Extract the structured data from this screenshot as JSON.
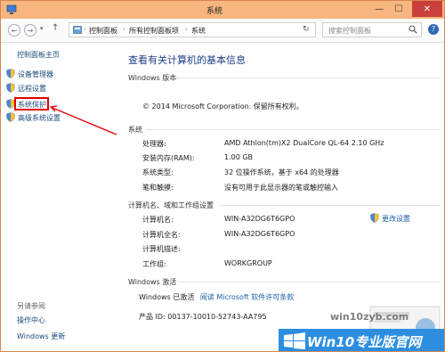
{
  "window": {
    "title": "系统"
  },
  "address": {
    "crumbs": [
      "控制面板",
      "所有控制面板项",
      "系统"
    ],
    "search_placeholder": "搜索控制面板"
  },
  "sidebar": {
    "home": "控制面板主页",
    "items": [
      {
        "label": "设备管理器",
        "icon": "shield-icon"
      },
      {
        "label": "远程设置",
        "icon": "shield-icon"
      },
      {
        "label": "系统保护",
        "icon": "shield-icon",
        "highlighted": true
      },
      {
        "label": "高级系统设置",
        "icon": "shield-icon"
      }
    ],
    "see_also": "另请参阅",
    "links": [
      "操作中心",
      "Windows 更新"
    ]
  },
  "main": {
    "title": "查看有关计算机的基本信息",
    "edition": {
      "heading": "Windows 版本",
      "copyright": "© 2014 Microsoft Corporation. 保留所有权利。"
    },
    "system": {
      "heading": "系统",
      "rows": [
        {
          "label": "处理器:",
          "value": "AMD Athlon(tm)X2 DualCore QL-64   2.10 GHz"
        },
        {
          "label": "安装内存(RAM):",
          "value": "1.00 GB"
        },
        {
          "label": "系统类型:",
          "value": "32 位操作系统，基于 x64 的处理器"
        },
        {
          "label": "笔和触摸:",
          "value": "没有可用于此显示器的笔或触控输入"
        }
      ]
    },
    "computer": {
      "heading": "计算机名、域和工作组设置",
      "rows": [
        {
          "label": "计算机名:",
          "value": "WIN-A32DG6T6GPO"
        },
        {
          "label": "计算机全名:",
          "value": "WIN-A32DG6T6GPO"
        },
        {
          "label": "计算机描述:",
          "value": ""
        },
        {
          "label": "工作组:",
          "value": "WORKGROUP"
        }
      ],
      "change_settings": "更改设置"
    },
    "activation": {
      "heading": "Windows 激活",
      "status": "Windows 已激活",
      "license_link": "阅读 Microsoft 软件许可条款",
      "product_id": "产品 ID: 00137-10010-52743-AA795"
    }
  },
  "watermark": {
    "url": "win10zyb.com",
    "banner": "Win10专业版官网"
  },
  "colors": {
    "titlebar": "#f7b57f",
    "link": "#1a5fa6",
    "heading": "#1e3e8c",
    "highlight": "#e00000"
  }
}
